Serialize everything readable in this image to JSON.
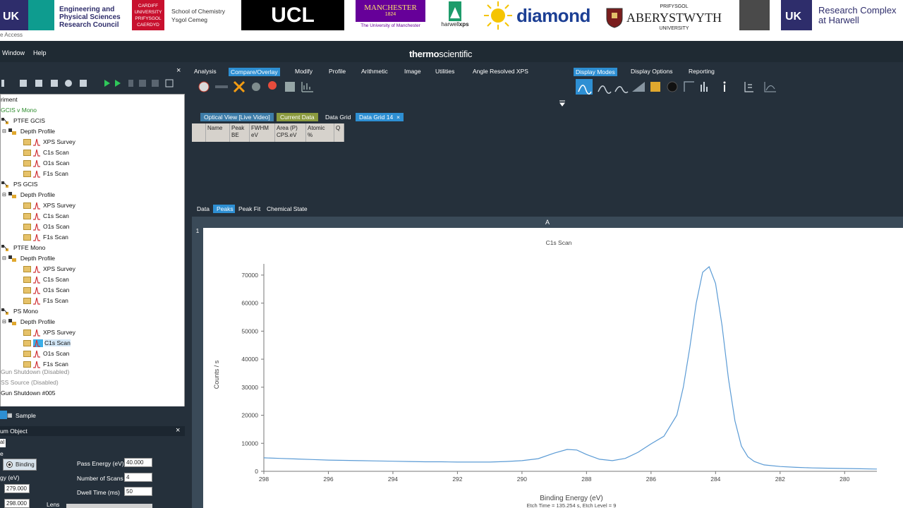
{
  "banner": {
    "epsrc_line1": "Engineering and",
    "epsrc_line2": "Physical Sciences",
    "epsrc_line3": "Research Council",
    "cardiff_line1": "CARDIFF",
    "cardiff_line2": "UNIVERSITY",
    "cardiff_line3": "PRIFYSGOL",
    "cardiff_line4": "CAERDYD",
    "chem_line1": "School of Chemistry",
    "chem_line2": "Ysgol Cemeg",
    "ucl": "UCL",
    "manchester": "MANCHESTER",
    "manchester_year": "1824",
    "manchester_sub": "The University of Manchester",
    "harwell_a": "harwell",
    "harwell_b": "xps",
    "diamond": "diamond",
    "aber_top": "PRIFYSGOL",
    "aber_main": "ABERYSTWYTH",
    "aber_sub": "UNIVERSITY",
    "rcah_line1": "Research Complex",
    "rcah_line2": "at Harwell",
    "access_text": "e Access"
  },
  "app": {
    "menu_window": "Window",
    "menu_help": "Help",
    "name_bold": "thermo",
    "name_light": "scientific"
  },
  "ribbon": {
    "analysis": "Analysis",
    "compare": "Compare/Overlay",
    "modify": "Modify",
    "profile": "Profile",
    "arithmetic": "Arithmetic",
    "image": "Image",
    "utilities": "Utilities",
    "arxps": "Angle Resolved XPS",
    "display_modes": "Display Modes",
    "display_options": "Display Options",
    "reporting": "Reporting"
  },
  "tree": {
    "experiment": "riment",
    "root": "GCIS v Mono",
    "groups": [
      {
        "name": "PTFE GCIS",
        "profile": "Depth Profile",
        "scans": [
          "XPS Survey",
          "C1s Scan",
          "O1s Scan",
          "F1s Scan"
        ]
      },
      {
        "name": "PS GCIS",
        "profile": "Depth Profile",
        "scans": [
          "XPS Survey",
          "C1s Scan",
          "O1s Scan",
          "F1s Scan"
        ]
      },
      {
        "name": "PTFE Mono",
        "profile": "Depth Profile",
        "scans": [
          "XPS Survey",
          "C1s Scan",
          "O1s Scan",
          "F1s Scan"
        ]
      },
      {
        "name": "PS Mono",
        "profile": "Depth Profile",
        "scans": [
          "XPS Survey",
          "C1s Scan",
          "O1s Scan",
          "F1s Scan"
        ]
      }
    ],
    "extra1": "Gun Shutdown (Disabled)",
    "extra2": "SS Source (Disabled)",
    "extra3": "Gun Shutdown #005"
  },
  "data_tabs": {
    "optical": "Optical View [Live Video]",
    "current": "Current Data",
    "grid": "Data Grid",
    "grid14": "Data Grid 14",
    "close": "×"
  },
  "grid_headers": [
    {
      "l1": "Name",
      "l2": ""
    },
    {
      "l1": "Peak",
      "l2": "BE"
    },
    {
      "l1": "FWHM",
      "l2": "eV"
    },
    {
      "l1": "Area (P)",
      "l2": "CPS.eV"
    },
    {
      "l1": "Atomic",
      "l2": "%"
    },
    {
      "l1": "Q",
      "l2": ""
    }
  ],
  "view_tabs": {
    "data": "Data",
    "peaks": "Peaks",
    "peakfit": "Peak Fit",
    "chemstate": "Chemical State"
  },
  "chart_header": {
    "col": "A",
    "row": "1"
  },
  "bottom": {
    "sample_tab": "Sample",
    "spectrum_obj": "um Object",
    "tab": "al",
    "e_lbl": "e",
    "binding": "Binding",
    "energy_lbl": "gy (eV)",
    "val1": "279.000",
    "val2": "298.000",
    "lens": "Lens",
    "pass_energy_lbl": "Pass Energy (eV)",
    "pass_energy": "40.000",
    "scans_lbl": "Number of Scans",
    "scans": "4",
    "dwell_lbl": "Dwell Time (ms)",
    "dwell": "50",
    "close": "×"
  },
  "chart_data": {
    "type": "line",
    "title": "C1s Scan",
    "xlabel": "Binding Energy (eV)",
    "ylabel": "Counts / s",
    "footer": "Etch Time = 135.254 s, Etch Level = 9",
    "xlim": [
      298,
      279
    ],
    "ylim": [
      0,
      74000
    ],
    "x_ticks": [
      "298",
      "296",
      "294",
      "292",
      "290",
      "288",
      "286",
      "284",
      "282",
      "280"
    ],
    "y_ticks": [
      "0",
      "10000",
      "20000",
      "30000",
      "40000",
      "50000",
      "60000",
      "70000"
    ],
    "series": [
      {
        "color": "#5b9bd5",
        "x": [
          298,
          297.5,
          297,
          296.5,
          296,
          295.5,
          295,
          294.5,
          294,
          293.5,
          293,
          292.5,
          292,
          291.5,
          291,
          290.5,
          290,
          289.5,
          289,
          288.6,
          288.3,
          288,
          287.6,
          287.2,
          286.8,
          286.4,
          286.0,
          285.6,
          285.2,
          285.0,
          284.8,
          284.6,
          284.4,
          284.2,
          284.0,
          283.8,
          283.6,
          283.4,
          283.2,
          283.0,
          282.8,
          282.5,
          282.0,
          281.5,
          281.0,
          280.5,
          280.0,
          279.5,
          279.0
        ],
        "y": [
          4800,
          4600,
          4400,
          4200,
          4000,
          3900,
          3800,
          3700,
          3600,
          3500,
          3400,
          3400,
          3300,
          3300,
          3300,
          3500,
          3800,
          4500,
          6500,
          7800,
          7600,
          6000,
          4300,
          3800,
          4600,
          6800,
          9800,
          12500,
          20000,
          30000,
          44000,
          60000,
          71000,
          73000,
          67000,
          52000,
          33000,
          18000,
          9000,
          5200,
          3500,
          2300,
          1700,
          1400,
          1200,
          1100,
          1000,
          900,
          800
        ]
      }
    ]
  }
}
